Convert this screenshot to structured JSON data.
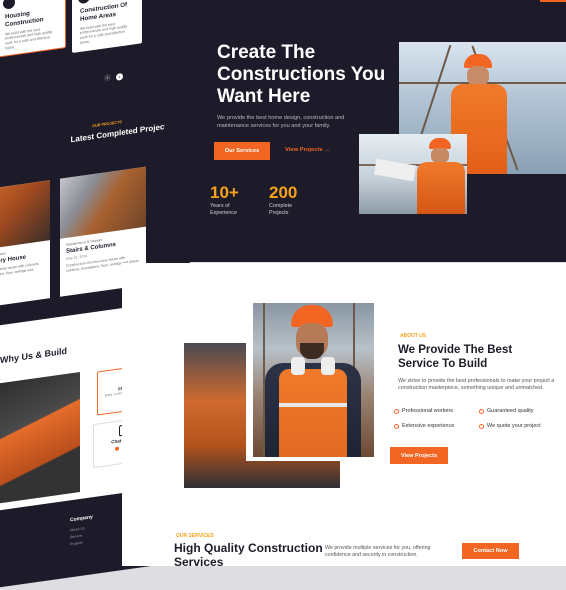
{
  "left_page": {
    "services": [
      {
        "title": "Housing Construction",
        "desc": "We build with the best professionals and high quality work for a safe and effective home."
      },
      {
        "title": "Construction Of Home Areas",
        "desc": "We build with the best professionals and high quality work for a safe and effective home."
      }
    ],
    "projects_section": {
      "eyebrow": "OUR PROJECTS",
      "title_part1": "Latest ",
      "title_part2": "Completed Projects"
    },
    "projects": [
      {
        "category": "Construction",
        "name": "Luxury House",
        "date": "",
        "desc": "Luxury family house with columns, foundations, floor, ceilings and others."
      },
      {
        "category": "Maintenance & Repairs",
        "name": "Stairs & Columns",
        "date": "May 21, 2024",
        "desc": "Construction of a two-story house with columns, foundations, floor, ceilings and others."
      }
    ],
    "why_title": "Why Us & Build",
    "feature_boxes": [
      {
        "title": "Fin here",
        "desc": "Easy, Lorem ipsum dolor sit..."
      },
      {
        "title": "Chat with m",
        "desc": ""
      }
    ],
    "footer": {
      "heading": "Company",
      "links": [
        "About Us",
        "Service",
        "Projects"
      ]
    }
  },
  "hero": {
    "title": "Create The Constructions You Want Here",
    "subtitle": "We provide the best home design, construction and maintenance services for you and your family.",
    "primary_btn": "Our Services",
    "secondary_btn": "View Projects",
    "arrow": "→",
    "stats": [
      {
        "value": "10+",
        "label": "Years of Experience"
      },
      {
        "value": "200",
        "label": "Complete Projects"
      }
    ]
  },
  "about": {
    "eyebrow": "ABOUT US",
    "title": "We Provide The Best Service To Build",
    "desc": "We strive to provide the best professionals to make your project a construction masterpiece, something unique and unmatched.",
    "features": [
      "Professional workers",
      "Guaranteed quality",
      "Extensive experience",
      "We quote your project"
    ],
    "button": "View Projects"
  },
  "services": {
    "eyebrow": "OUR SERVICES",
    "title": "High Quality Construction Services",
    "desc": "We provide multiple services for you, offering confidence and security in construction.",
    "button": "Contact Now"
  },
  "colors": {
    "accent": "#f26522",
    "yellow": "#f7a21b",
    "dark": "#1d1b29"
  }
}
